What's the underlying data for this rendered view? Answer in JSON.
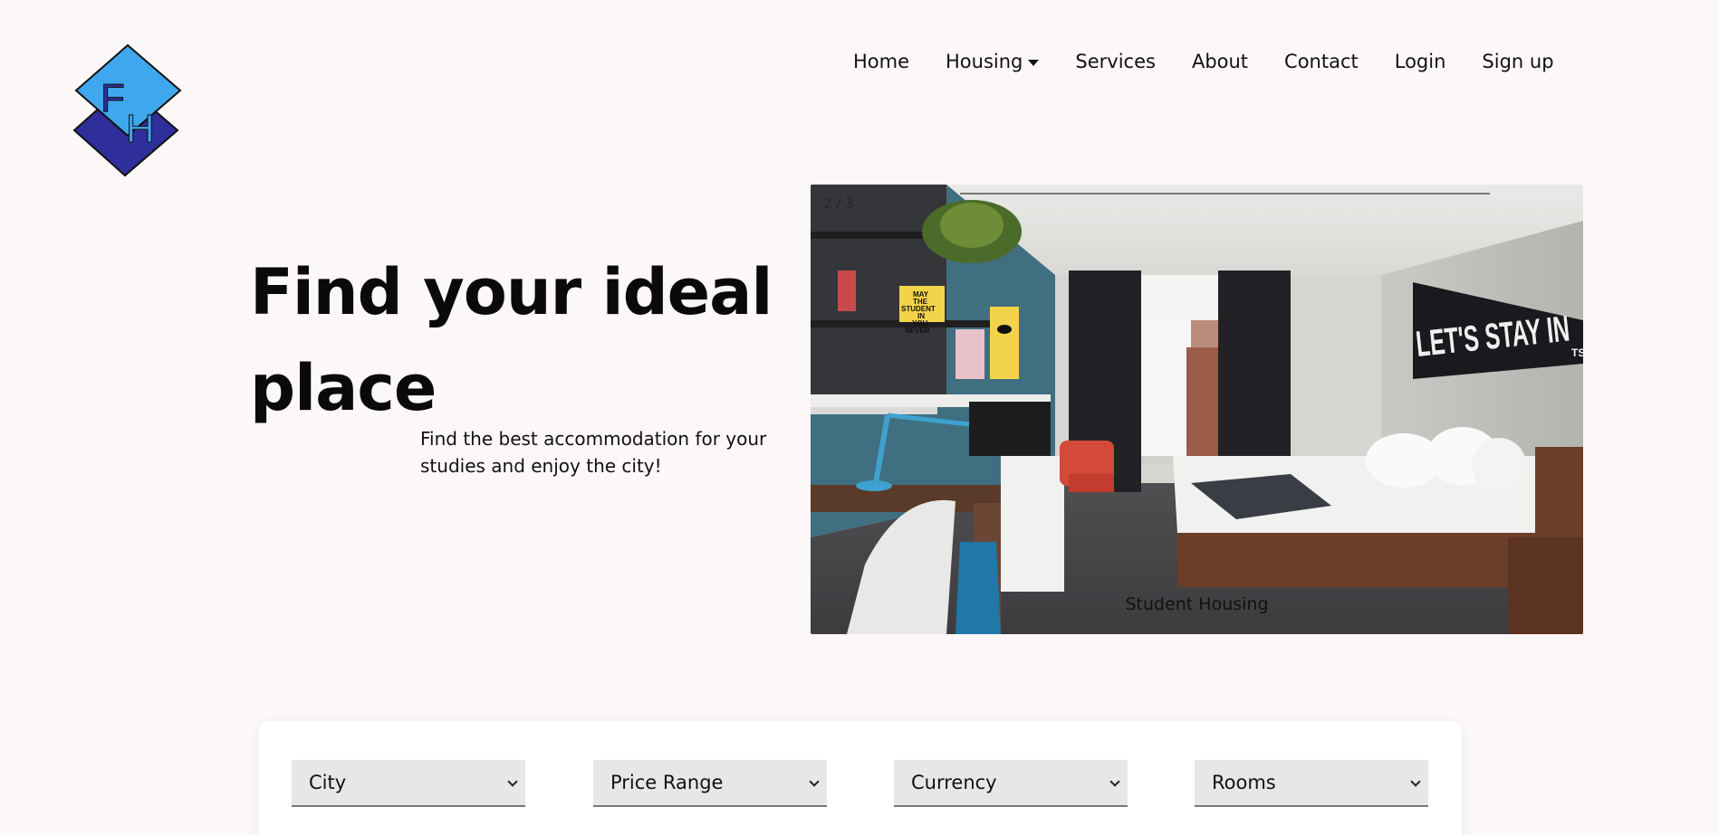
{
  "logo": {
    "letters": [
      "F",
      "H"
    ],
    "colors": {
      "top": "#3fa7ee",
      "bottom": "#2e2f9a",
      "outline": "#111111"
    }
  },
  "nav": {
    "home": "Home",
    "housing": "Housing",
    "services": "Services",
    "about": "About",
    "contact": "Contact",
    "login": "Login",
    "signup": "Sign up"
  },
  "hero": {
    "title_line1": "Find your ideal",
    "title_line2": "place",
    "subtitle_line1": "Find the best accommodation for your",
    "subtitle_line2": "studies and enjoy the city!"
  },
  "slideshow": {
    "counter": "2 / 3",
    "caption": "Student Housing",
    "poster_text": [
      "MAY",
      "THE",
      "STUDENT",
      "IN",
      "YOU",
      "NEVER"
    ],
    "pennant_text": "LET'S STAY IN",
    "pennant_suffix": "TS"
  },
  "filters": {
    "city": "City",
    "price": "Price Range",
    "currency": "Currency",
    "rooms": "Rooms"
  },
  "colors": {
    "page_bg": "#fcf8f7",
    "select_bg": "#e7e7ea",
    "wall_teal": "#3f6f80"
  }
}
